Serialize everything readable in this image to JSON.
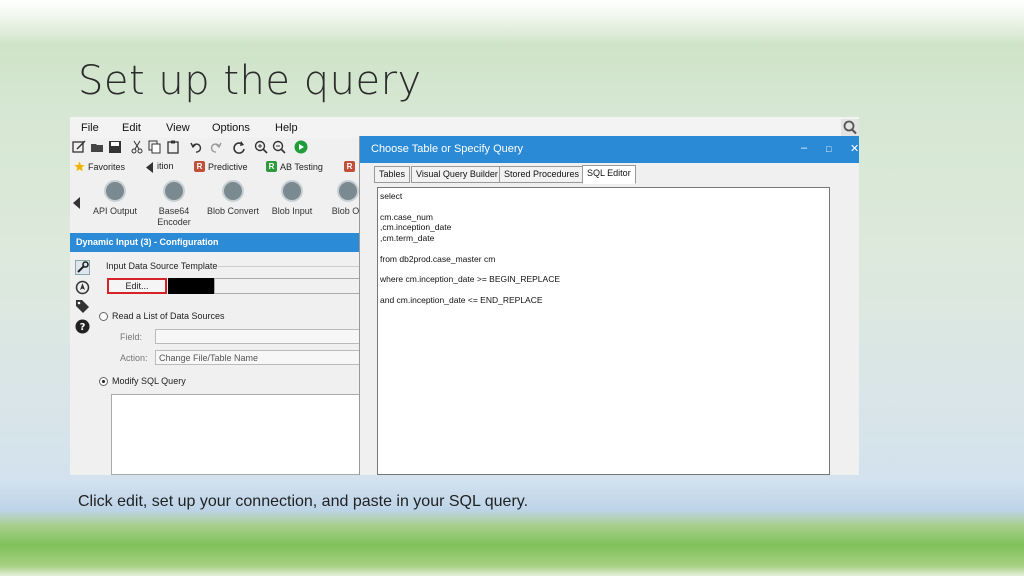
{
  "slide": {
    "title": "Set up the query",
    "caption": "Click edit, set up your connection, and paste in your SQL query."
  },
  "menu": {
    "items": [
      "File",
      "Edit",
      "View",
      "Options",
      "Help"
    ]
  },
  "categories": {
    "favorites": "Favorites",
    "partial": "ition",
    "predictive": "Predictive",
    "ab_testing": "AB Testing",
    "badge_r": "R",
    "colors": {
      "r_badge": "#c0503a",
      "ab_badge": "#2e9a3e"
    }
  },
  "tools": [
    "API Output",
    "Base64 Encoder",
    "Blob Convert",
    "Blob Input",
    "Blob Ou"
  ],
  "config": {
    "header": "Dynamic Input (3) - Configuration",
    "input_template_label": "Input Data Source Template",
    "edit_button": "Edit...",
    "read_list_label": "Read a List of Data Sources",
    "field_label": "Field:",
    "action_label": "Action:",
    "action_value": "Change File/Table Name",
    "modify_sql_label": "Modify SQL Query",
    "modify_sql_selected": true
  },
  "dialog": {
    "title": "Choose Table or Specify Query",
    "tabs": [
      "Tables",
      "Visual Query Builder",
      "Stored Procedures",
      "SQL Editor"
    ],
    "active_tab": "SQL Editor",
    "sql": [
      "select",
      "",
      "cm.case_num",
      ",cm.inception_date",
      ",cm.term_date",
      "",
      "from db2prod.case_master cm",
      "",
      "where cm.inception_date >= BEGIN_REPLACE",
      "",
      "and cm.inception_date <= END_REPLACE"
    ]
  },
  "colors": {
    "accent": "#2a8ad6",
    "edit_highlight": "#d6232a"
  }
}
